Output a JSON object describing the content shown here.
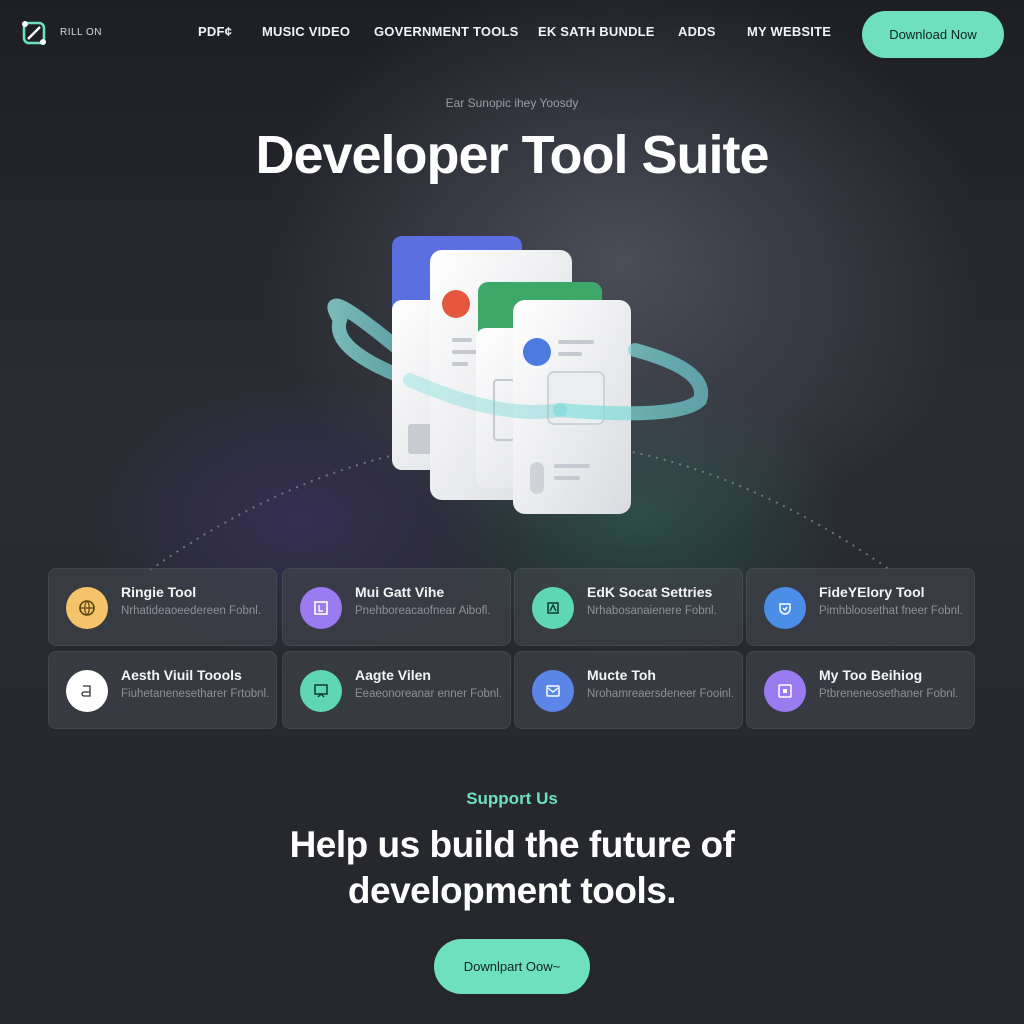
{
  "nav": {
    "logo_text": "RILL ON",
    "links": [
      "PDF¢",
      "MUSIC VIDEO",
      "GOVERNMENT TOOLS",
      "EK SATH BUNDLE",
      "ADDS",
      "MY WEBSITE"
    ],
    "download_label": "Download Now"
  },
  "hero": {
    "eyebrow": "Ear Sunopic ihey Yoosdy",
    "title": "Developer  Tool Suite"
  },
  "cards": [
    {
      "title": "Ringie Tool",
      "desc": "Nrhatideaoeedereen Fobnl.",
      "icon": "globe-icon",
      "color": "#f5c46a"
    },
    {
      "title": "Mui Gatt Vihe",
      "desc": "Pnehboreacaofnear Aibofl.",
      "icon": "frame-icon",
      "color": "#9b7bf0"
    },
    {
      "title": "EdK Socat Settries",
      "desc": "Nrhabosanaienere Fobnl.",
      "icon": "pin-icon",
      "color": "#5fd7b6"
    },
    {
      "title": "FideYElory Tool",
      "desc": "Pimhbloosethat fneer Fobnl.",
      "icon": "shield-icon",
      "color": "#4c8de8"
    },
    {
      "title": "Aesth Viuil Toools",
      "desc": "Fiuhetanenesetharer Frtobnl.",
      "icon": "script-icon",
      "color": "#ffffff"
    },
    {
      "title": "Aagte Vilen",
      "desc": "Eeaeonoreanar enner Fobnl.",
      "icon": "board-icon",
      "color": "#5fd7b6"
    },
    {
      "title": "Mucte Toh",
      "desc": "Nrohamreaersdeneer Fooinl.",
      "icon": "mail-icon",
      "color": "#5b86e8"
    },
    {
      "title": "My Too Beihiog",
      "desc": "Ptbreneneosethaner Fobnl.",
      "icon": "square-icon",
      "color": "#9b7bf0"
    }
  ],
  "support": {
    "label": "Support Us",
    "title_line1": "Help us build the future of",
    "title_line2": "development tools.",
    "cta_label": "Downlpart Oow~"
  }
}
